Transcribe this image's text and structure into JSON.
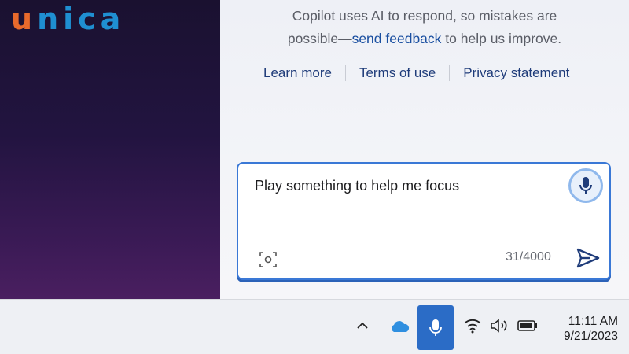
{
  "logo": {
    "text": "unica"
  },
  "copilot": {
    "disclaimer_line1": "Copilot uses AI to respond, so mistakes are",
    "disclaimer_prefix": "possible—",
    "disclaimer_link": "send feedback",
    "disclaimer_suffix": " to help us improve.",
    "links": [
      "Learn more",
      "Terms of use",
      "Privacy statement"
    ]
  },
  "chat": {
    "input_value": "Play something to help me focus",
    "char_count": "31/4000",
    "mic_icon": "microphone-icon",
    "camera_icon": "screenshot-camera-icon",
    "send_icon": "send-icon"
  },
  "taskbar": {
    "icons": [
      "chevron-up-icon",
      "onedrive-cloud-icon",
      "microphone-icon",
      "wifi-icon",
      "volume-icon",
      "battery-icon"
    ],
    "time": "11:11 AM",
    "date": "9/21/2023"
  },
  "colors": {
    "accent": "#2b6cc6",
    "link": "#1a4fa0",
    "logo_orange": "#e86a2c",
    "logo_blue": "#1f8fd1"
  }
}
